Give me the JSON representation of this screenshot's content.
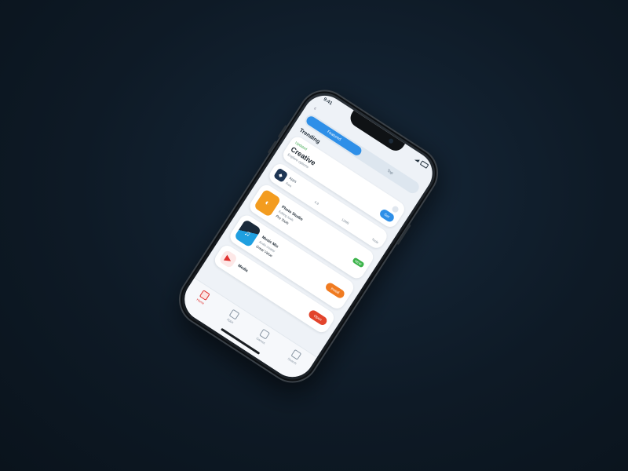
{
  "status": {
    "time": "9:41"
  },
  "nav": {
    "back_label": "‹"
  },
  "segments": [
    {
      "label": "Featured",
      "active": true
    },
    {
      "label": "Top",
      "active": false
    }
  ],
  "section_title": "Trending",
  "hero": {
    "tag": "Updated",
    "title": "Creative",
    "subtitle": "Explore options",
    "cta": "Get"
  },
  "mini_card": {
    "label": "Apps",
    "stats": [
      "Free",
      "4.8",
      "12MB",
      "Tools"
    ]
  },
  "items": [
    {
      "title": "Photo Studio",
      "subtitle": "Editing tools",
      "note": "Pro Tools",
      "badge": "NEW",
      "icon_color": "#f39c1f",
      "icon_glyph": "◐"
    },
    {
      "title": "Music Mix",
      "subtitle": "Audio creator",
      "note": "Great Value",
      "cta": "Install",
      "cta_color": "#f07b21",
      "icon_color": "#1f9fe0",
      "icon_glyph": "♫"
    },
    {
      "title": "Media",
      "subtitle": "",
      "cta": "Open",
      "cta_color": "#e2432b",
      "icon_color": "#e0312f",
      "icon_glyph": "▶"
    }
  ],
  "tabbar": [
    {
      "label": "Home",
      "active": true
    },
    {
      "label": "Apps",
      "active": false
    },
    {
      "label": "Games",
      "active": false
    },
    {
      "label": "Search",
      "active": false
    }
  ],
  "colors": {
    "accent": "#2e8fe8",
    "success": "#3bb34a",
    "warning": "#f39c1f",
    "danger": "#e0312f"
  }
}
